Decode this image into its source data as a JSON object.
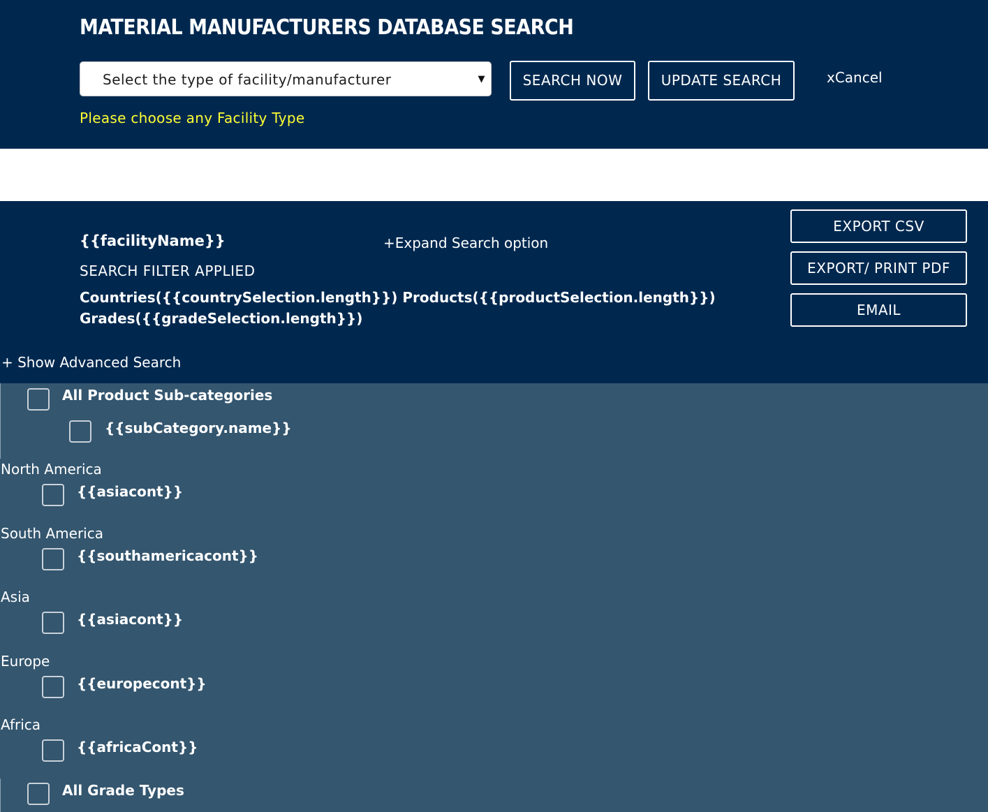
{
  "header": {
    "title": "MATERIAL MANUFACTURERS DATABASE SEARCH",
    "facility_select": {
      "value": "Select the type of facility/manufacturer",
      "arrow": "▼"
    },
    "search_now_label": "SEARCH NOW",
    "update_search_label": "UPDATE SEARCH",
    "cancel_label": "xCancel",
    "warning": "Please choose any Facility Type"
  },
  "results": {
    "facility_name": "{{facilityName}}",
    "expand_label": "+Expand Search option",
    "filter_applied_label": "SEARCH FILTER APPLIED",
    "filter_line_1": "Countries({{countrySelection.length}}) Products({{productSelection.length}})",
    "filter_line_2": "Grades({{gradeSelection.length}})",
    "export_csv_label": "EXPORT CSV",
    "export_pdf_label": "EXPORT/ PRINT PDF",
    "email_label": "EMAIL",
    "advanced_label": "+ Show Advanced Search"
  },
  "advanced": {
    "all_subcategories_label": "All Product Sub-categories",
    "subcategory_label": "{{subCategory.name}}",
    "regions": [
      {
        "name": "North America",
        "option": "{{asiacont}}"
      },
      {
        "name": "South America",
        "option": "{{southamericacont}}"
      },
      {
        "name": "Asia",
        "option": "{{asiacont}}"
      },
      {
        "name": "Europe",
        "option": "{{europecont}}"
      },
      {
        "name": "Africa",
        "option": "{{africaCont}}"
      }
    ],
    "all_grades_label": "All Grade Types"
  },
  "colors": {
    "header_bg": "#00284f",
    "panel_bg": "#34566f",
    "warning": "#ffff33"
  }
}
